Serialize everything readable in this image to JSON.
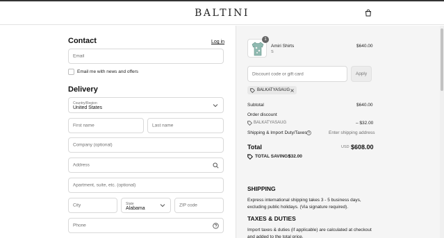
{
  "brand": "BALTINI",
  "header": {
    "cart_icon": "shopping-bag-icon"
  },
  "contact": {
    "heading": "Contact",
    "login_link": "Log in",
    "email_placeholder": "Email",
    "newsletter_label": "Email me with news and offers"
  },
  "delivery": {
    "heading": "Delivery",
    "country_label": "Country/Region",
    "country_value": "United States",
    "first_name_placeholder": "First name",
    "last_name_placeholder": "Last name",
    "company_placeholder": "Company (optional)",
    "address_placeholder": "Address",
    "apartment_placeholder": "Apartment, suite, etc. (optional)",
    "city_placeholder": "City",
    "state_label": "State",
    "state_value": "Alabama",
    "zip_placeholder": "ZIP code",
    "phone_placeholder": "Phone"
  },
  "summary": {
    "product": {
      "name": "Amiri Shirts",
      "variant": "S",
      "price": "$640.00",
      "quantity": "1"
    },
    "discount_placeholder": "Discount code or gift card",
    "apply_label": "Apply",
    "applied_code": "BALKATYASAUG",
    "subtotal_label": "Subtotal",
    "subtotal_value": "$640.00",
    "order_discount_label": "Order discount",
    "discount_code": "BALKATYASAUG",
    "discount_value": "– $32.00",
    "shipping_label": "Shipping & Import Duty/Taxes",
    "shipping_value": "Enter shipping address",
    "total_label": "Total",
    "total_currency": "USD",
    "total_value": "$608.00",
    "savings_label": "TOTAL SAVINGS",
    "savings_value": "$32.00"
  },
  "info": {
    "shipping_heading": "SHIPPING",
    "shipping_text": "Express international shipping takes 3 - 5 business days, excluding public holidays. (Via signature required).",
    "taxes_heading": "TAXES & DUTIES",
    "taxes_text": "Import taxes & duties (if applicable) are calculated at checkout and added to the total price."
  },
  "colors": {
    "accent": "#111111",
    "muted": "#707070",
    "panel_bg": "#f5f5f5",
    "border": "#d9d9d9"
  }
}
